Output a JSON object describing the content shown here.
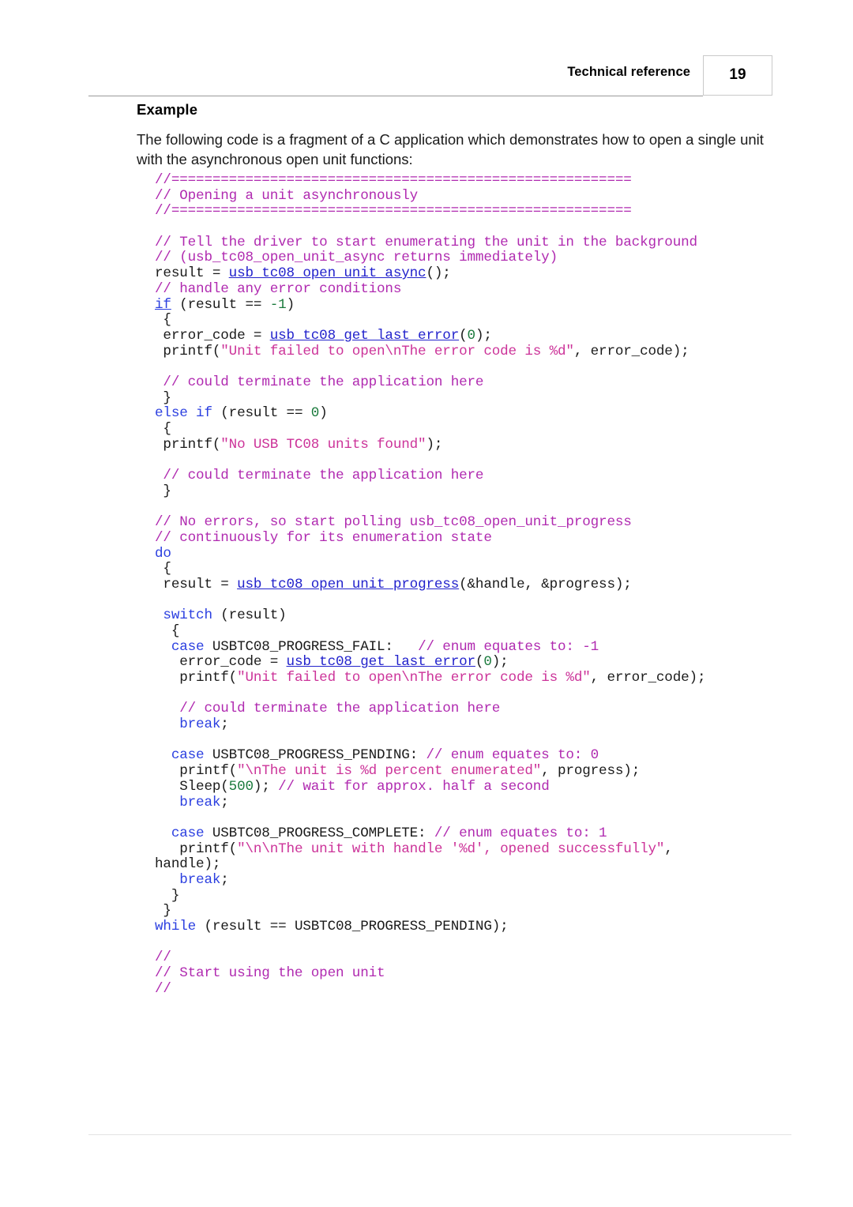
{
  "header": {
    "title": "Technical reference",
    "page_number": "19"
  },
  "body": {
    "section_heading": "Example",
    "intro": "The following code is a fragment of a C application which demonstrates how to open a single unit with the asynchronous open unit functions:"
  },
  "colors": {
    "comment": "#b02ab0",
    "string": "#cc3399",
    "keyword": "#2b3fe0",
    "number": "#1a7a3c",
    "function_link": "#2222cc",
    "plain": "#1a1a1a",
    "rule": "#9a9a9a",
    "page_box_border": "#c9c9c9"
  },
  "code": {
    "language": "C",
    "lines": [
      [
        {
          "t": "comment",
          "v": "//========================================================"
        }
      ],
      [
        {
          "t": "comment",
          "v": "// Opening a unit asynchronously"
        }
      ],
      [
        {
          "t": "comment",
          "v": "//========================================================"
        }
      ],
      [],
      [
        {
          "t": "comment",
          "v": "// Tell the driver to start enumerating the unit in the background"
        }
      ],
      [
        {
          "t": "comment",
          "v": "// (usb_tc08_open_unit_async returns immediately)"
        }
      ],
      [
        {
          "t": "plain",
          "v": "result = "
        },
        {
          "t": "func",
          "v": "usb_tc08_open_unit_async"
        },
        {
          "t": "plain",
          "v": "();"
        }
      ],
      [
        {
          "t": "comment",
          "v": "// handle any error conditions"
        }
      ],
      [
        {
          "t": "if",
          "v": "if"
        },
        {
          "t": "plain",
          "v": " (result == "
        },
        {
          "t": "number",
          "v": "-1"
        },
        {
          "t": "plain",
          "v": ")"
        }
      ],
      [
        {
          "t": "plain",
          "v": " {"
        }
      ],
      [
        {
          "t": "plain",
          "v": " error_code = "
        },
        {
          "t": "func",
          "v": "usb_tc08_get_last_error"
        },
        {
          "t": "plain",
          "v": "("
        },
        {
          "t": "number",
          "v": "0"
        },
        {
          "t": "plain",
          "v": ");"
        }
      ],
      [
        {
          "t": "plain",
          "v": " printf("
        },
        {
          "t": "string",
          "v": "\"Unit failed to open\\nThe error code is %d\""
        },
        {
          "t": "plain",
          "v": ", error_code);"
        }
      ],
      [],
      [
        {
          "t": "plain",
          "v": " "
        },
        {
          "t": "comment",
          "v": "// could terminate the application here"
        }
      ],
      [
        {
          "t": "plain",
          "v": " }"
        }
      ],
      [
        {
          "t": "keyword",
          "v": "else if"
        },
        {
          "t": "plain",
          "v": " (result == "
        },
        {
          "t": "number",
          "v": "0"
        },
        {
          "t": "plain",
          "v": ")"
        }
      ],
      [
        {
          "t": "plain",
          "v": " {"
        }
      ],
      [
        {
          "t": "plain",
          "v": " printf("
        },
        {
          "t": "string",
          "v": "\"No USB TC08 units found\""
        },
        {
          "t": "plain",
          "v": ");"
        }
      ],
      [],
      [
        {
          "t": "plain",
          "v": " "
        },
        {
          "t": "comment",
          "v": "// could terminate the application here"
        }
      ],
      [
        {
          "t": "plain",
          "v": " }"
        }
      ],
      [],
      [
        {
          "t": "comment",
          "v": "// No errors, so start polling usb_tc08_open_unit_progress"
        }
      ],
      [
        {
          "t": "comment",
          "v": "// continuously for its enumeration state"
        }
      ],
      [
        {
          "t": "keyword",
          "v": "do"
        }
      ],
      [
        {
          "t": "plain",
          "v": " {"
        }
      ],
      [
        {
          "t": "plain",
          "v": " result = "
        },
        {
          "t": "func",
          "v": "usb_tc08_open_unit_progress"
        },
        {
          "t": "plain",
          "v": "(&handle, &progress);"
        }
      ],
      [],
      [
        {
          "t": "keyword",
          "v": " switch"
        },
        {
          "t": "plain",
          "v": " (result)"
        }
      ],
      [
        {
          "t": "plain",
          "v": "  {"
        }
      ],
      [
        {
          "t": "keyword",
          "v": "  case"
        },
        {
          "t": "plain",
          "v": " USBTC08_PROGRESS_FAIL:   "
        },
        {
          "t": "comment",
          "v": "// enum equates to: -1"
        }
      ],
      [
        {
          "t": "plain",
          "v": "   error_code = "
        },
        {
          "t": "func",
          "v": "usb_tc08_get_last_error"
        },
        {
          "t": "plain",
          "v": "("
        },
        {
          "t": "number",
          "v": "0"
        },
        {
          "t": "plain",
          "v": ");"
        }
      ],
      [
        {
          "t": "plain",
          "v": "   printf("
        },
        {
          "t": "string",
          "v": "\"Unit failed to open\\nThe error code is %d\""
        },
        {
          "t": "plain",
          "v": ", error_code);"
        }
      ],
      [],
      [
        {
          "t": "plain",
          "v": "   "
        },
        {
          "t": "comment",
          "v": "// could terminate the application here"
        }
      ],
      [
        {
          "t": "keyword",
          "v": "   break"
        },
        {
          "t": "plain",
          "v": ";"
        }
      ],
      [],
      [
        {
          "t": "keyword",
          "v": "  case"
        },
        {
          "t": "plain",
          "v": " USBTC08_PROGRESS_PENDING: "
        },
        {
          "t": "comment",
          "v": "// enum equates to: 0"
        }
      ],
      [
        {
          "t": "plain",
          "v": "   printf("
        },
        {
          "t": "string",
          "v": "\"\\nThe unit is %d percent enumerated\""
        },
        {
          "t": "plain",
          "v": ", progress);"
        }
      ],
      [
        {
          "t": "plain",
          "v": "   Sleep("
        },
        {
          "t": "number",
          "v": "500"
        },
        {
          "t": "plain",
          "v": "); "
        },
        {
          "t": "comment",
          "v": "// wait for approx. half a second"
        }
      ],
      [
        {
          "t": "keyword",
          "v": "   break"
        },
        {
          "t": "plain",
          "v": ";"
        }
      ],
      [],
      [
        {
          "t": "keyword",
          "v": "  case"
        },
        {
          "t": "plain",
          "v": " USBTC08_PROGRESS_COMPLETE: "
        },
        {
          "t": "comment",
          "v": "// enum equates to: 1"
        }
      ],
      [
        {
          "t": "plain",
          "v": "   printf("
        },
        {
          "t": "string",
          "v": "\"\\n\\nThe unit with handle '%d', opened successfully\""
        },
        {
          "t": "plain",
          "v": ","
        }
      ],
      [
        {
          "t": "plain",
          "v": "handle);"
        }
      ],
      [
        {
          "t": "keyword",
          "v": "   break"
        },
        {
          "t": "plain",
          "v": ";"
        }
      ],
      [
        {
          "t": "plain",
          "v": "  }"
        }
      ],
      [
        {
          "t": "plain",
          "v": " }"
        }
      ],
      [
        {
          "t": "keyword",
          "v": "while"
        },
        {
          "t": "plain",
          "v": " (result == USBTC08_PROGRESS_PENDING);"
        }
      ],
      [],
      [
        {
          "t": "comment",
          "v": "//"
        }
      ],
      [
        {
          "t": "comment",
          "v": "// Start using the open unit"
        }
      ],
      [
        {
          "t": "comment",
          "v": "//"
        }
      ]
    ]
  }
}
